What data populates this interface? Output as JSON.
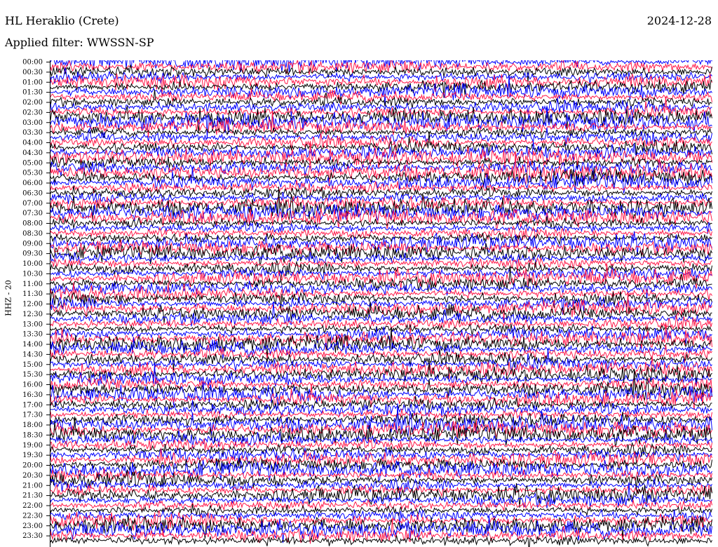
{
  "header": {
    "station": "HL Heraklio (Crete)",
    "date": "2024-12-28",
    "filter_label": "Applied filter: WWSSN-SP"
  },
  "chart_data": {
    "type": "line",
    "title": "HL Heraklio (Crete)",
    "date": "2024-12-28",
    "ylabel": "HHZ - 20",
    "grid": false,
    "y_tick_labels": [
      "00:00",
      "00:30",
      "01:00",
      "01:30",
      "02:00",
      "02:30",
      "03:00",
      "03:30",
      "04:00",
      "04:30",
      "05:00",
      "05:30",
      "06:00",
      "06:30",
      "07:00",
      "07:30",
      "08:00",
      "08:30",
      "09:00",
      "09:30",
      "10:00",
      "10:30",
      "11:00",
      "11:30",
      "12:00",
      "12:30",
      "13:00",
      "13:30",
      "14:00",
      "14:30",
      "15:00",
      "15:30",
      "16:00",
      "16:30",
      "17:00",
      "17:30",
      "18:00",
      "18:30",
      "19:00",
      "19:30",
      "20:00",
      "20:30",
      "21:00",
      "21:30",
      "22:00",
      "22:30",
      "23:00",
      "23:30"
    ],
    "trace_colors": [
      "#0000ff",
      "#ff1a4a",
      "#000000"
    ],
    "trace_color_cycle": "blue, red, black"
  }
}
